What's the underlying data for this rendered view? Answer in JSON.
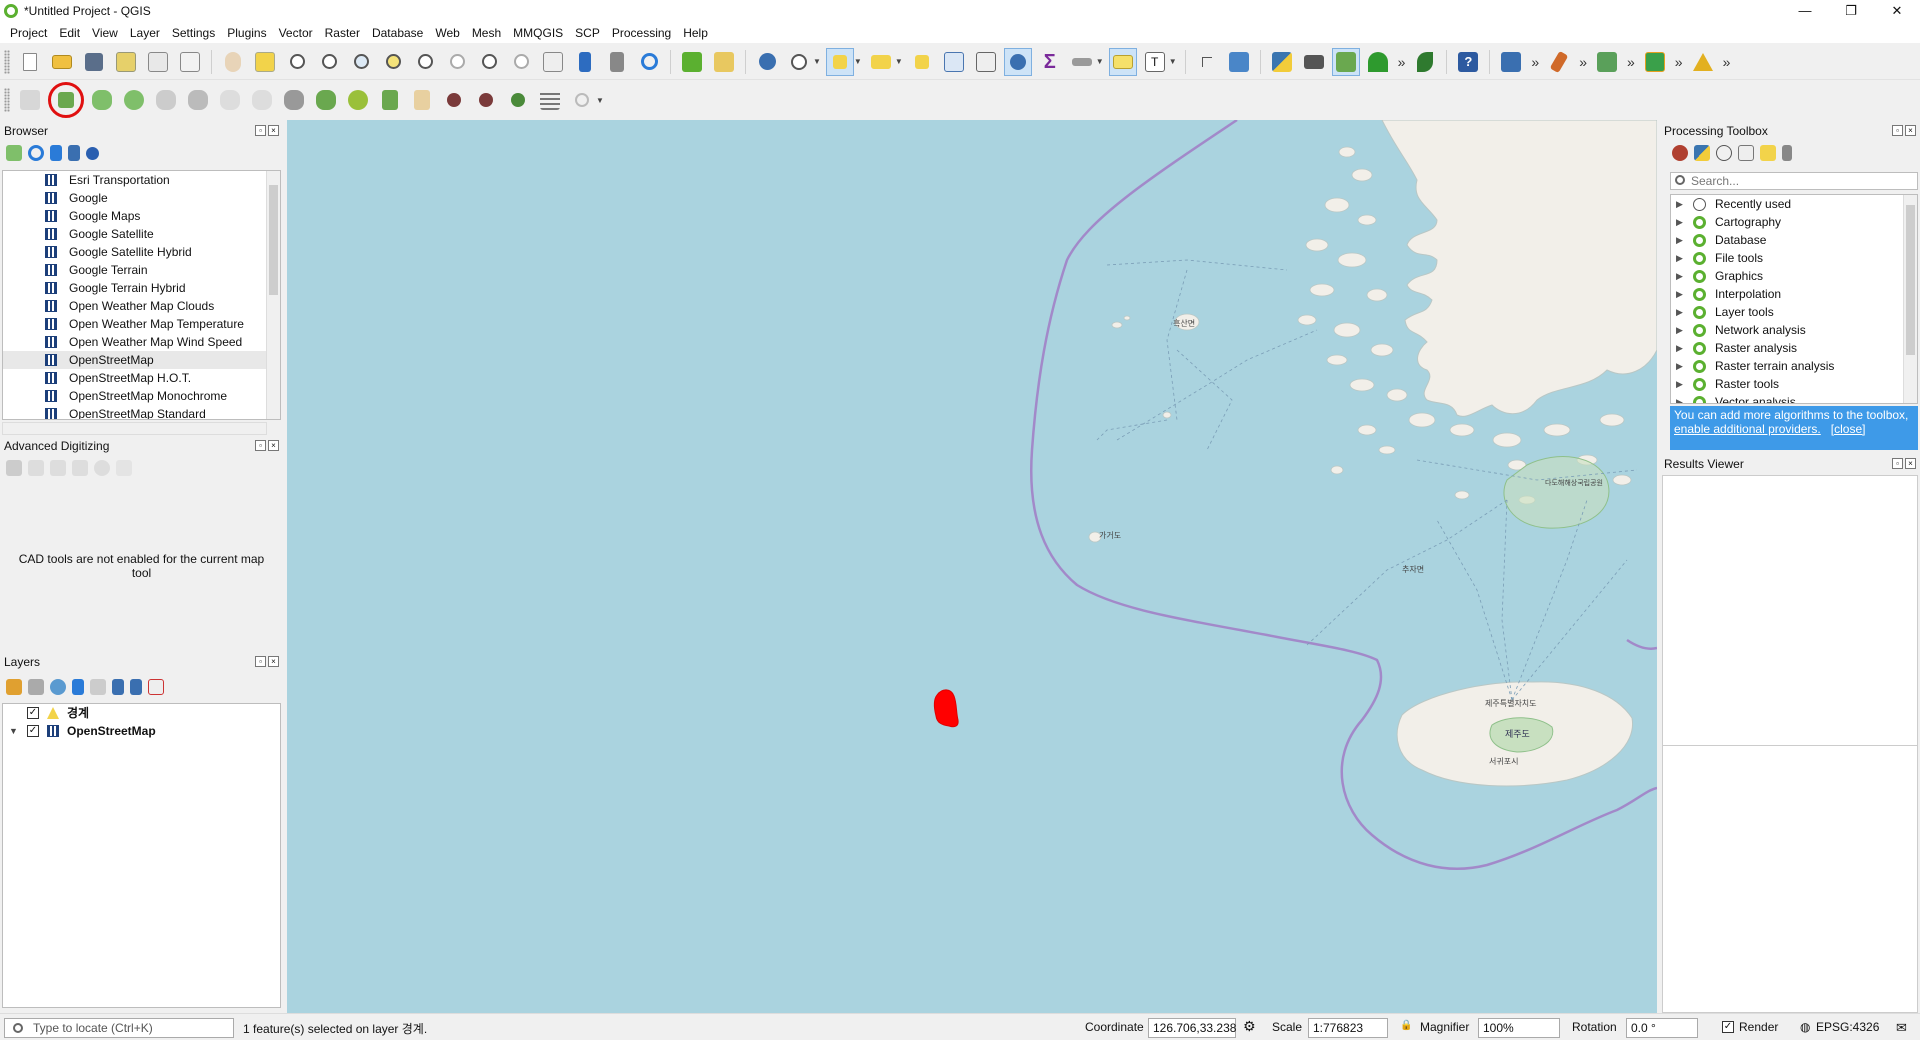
{
  "window": {
    "title": "*Untitled Project - QGIS"
  },
  "menu": [
    "Project",
    "Edit",
    "View",
    "Layer",
    "Settings",
    "Plugins",
    "Vector",
    "Raster",
    "Database",
    "Web",
    "Mesh",
    "MMQGIS",
    "SCP",
    "Processing",
    "Help"
  ],
  "browser": {
    "title": "Browser",
    "items": [
      "Esri Transportation",
      "Google",
      "Google Maps",
      "Google Satellite",
      "Google Satellite Hybrid",
      "Google Terrain",
      "Google Terrain Hybrid",
      "Open Weather Map Clouds",
      "Open Weather Map Temperature",
      "Open Weather Map Wind Speed",
      "OpenStreetMap",
      "OpenStreetMap H.O.T.",
      "OpenStreetMap Monochrome",
      "OpenStreetMap Standard"
    ],
    "selected": "OpenStreetMap"
  },
  "advanced_digitizing": {
    "title": "Advanced Digitizing",
    "message": "CAD tools are not enabled for the current map tool"
  },
  "layers": {
    "title": "Layers",
    "items": [
      {
        "name": "경계",
        "checked": true,
        "icon": "vector-layer-icon"
      },
      {
        "name": "OpenStreetMap",
        "checked": true,
        "icon": "xyz-tile-icon"
      }
    ]
  },
  "processing": {
    "title": "Processing Toolbox",
    "search_placeholder": "Search...",
    "items": [
      "Recently used",
      "Cartography",
      "Database",
      "File tools",
      "Graphics",
      "Interpolation",
      "Layer tools",
      "Network analysis",
      "Raster analysis",
      "Raster terrain analysis",
      "Raster tools",
      "Vector analysis"
    ],
    "info_text": "You can add more algorithms to the toolbox,",
    "info_link": "enable additional providers.",
    "info_close": "[close]"
  },
  "results": {
    "title": "Results Viewer"
  },
  "map": {
    "labels": {
      "heuksan": "흑산면",
      "gageo": "가거도",
      "chuja": "추자면",
      "jeju": "제주도",
      "jeju_city": "제주특별자치도",
      "seogwipo": "서귀포시",
      "dadohae": "다도해해상국립공원"
    },
    "colors": {
      "sea": "#aad3df",
      "land": "#f2efe9",
      "boundary": "#a289c9",
      "selected_feature": "#ff0000"
    }
  },
  "status": {
    "locate_placeholder": "Type to locate (Ctrl+K)",
    "message": "1 feature(s) selected on layer 경계.",
    "coordinate_label": "Coordinate",
    "coordinate": "126.706,33.238",
    "scale_label": "Scale",
    "scale": "1:776823",
    "magnifier_label": "Magnifier",
    "magnifier": "100%",
    "rotation_label": "Rotation",
    "rotation": "0.0 °",
    "render_label": "Render",
    "crs": "EPSG:4326"
  }
}
